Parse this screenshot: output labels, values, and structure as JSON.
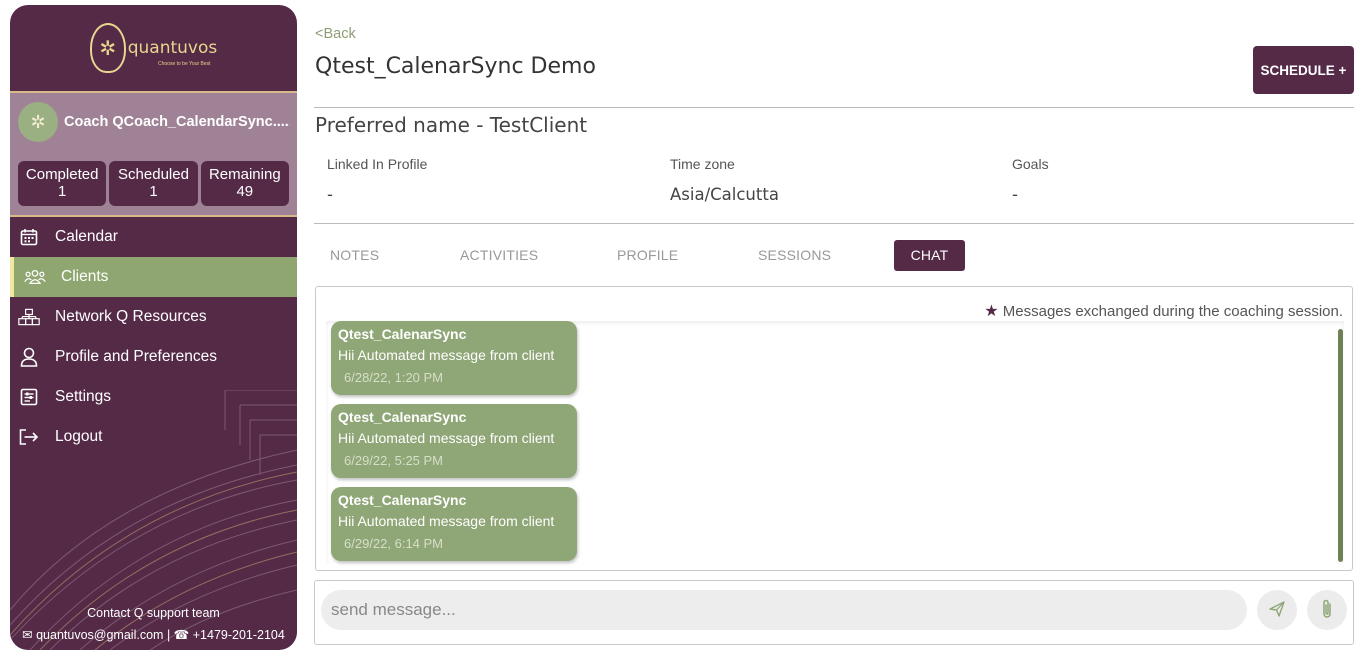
{
  "brand": {
    "name": "quantuvos",
    "tagline": "Choose to be Your Best",
    "logo_icon": "tree-q-logo"
  },
  "coach": {
    "name": "Coach QCoach_CalendarSync....."
  },
  "stats": [
    {
      "label": "Completed",
      "value": "1"
    },
    {
      "label": "Scheduled",
      "value": "1"
    },
    {
      "label": "Remaining",
      "value": "49"
    }
  ],
  "nav": [
    {
      "label": "Calendar",
      "icon": "calendar-icon"
    },
    {
      "label": "Clients",
      "icon": "users-icon",
      "active": true
    },
    {
      "label": "Network Q Resources",
      "icon": "network-icon"
    },
    {
      "label": "Profile and Preferences",
      "icon": "user-icon"
    },
    {
      "label": "Settings",
      "icon": "settings-icon"
    },
    {
      "label": "Logout",
      "icon": "logout-icon"
    }
  ],
  "footer": {
    "title": "Contact Q support team",
    "email": "quantuvos@gmail.com",
    "separator": "|",
    "phone": "+1479-201-2104"
  },
  "header": {
    "back": "<Back",
    "title": "Qtest_CalenarSync Demo",
    "schedule_button": "SCHEDULE +"
  },
  "client": {
    "preferred": "Preferred name  - TestClient",
    "fields": [
      {
        "label": "Linked In Profile",
        "value": "-"
      },
      {
        "label": "Time zone",
        "value": "Asia/Calcutta"
      },
      {
        "label": "Goals",
        "value": "-"
      }
    ]
  },
  "tabs": [
    "NOTES",
    "ACTIVITIES",
    "PROFILE",
    "SESSIONS",
    "CHAT"
  ],
  "active_tab": "CHAT",
  "chat": {
    "note": "Messages exchanged during the coaching session.",
    "messages": [
      {
        "from": "Qtest_CalenarSync",
        "text": "Hii Automated message from client",
        "time": "6/28/22, 1:20 PM"
      },
      {
        "from": "Qtest_CalenarSync",
        "text": "Hii Automated message from client",
        "time": "6/29/22, 5:25 PM"
      },
      {
        "from": "Qtest_CalenarSync",
        "text": "Hii Automated message from client",
        "time": "6/29/22, 6:14 PM"
      }
    ]
  },
  "composer": {
    "placeholder": "send message...",
    "send_icon": "send-icon",
    "attach_icon": "paperclip-icon"
  },
  "colors": {
    "primary": "#542a47",
    "accent": "#8fa670",
    "gold": "#e8d58e"
  }
}
